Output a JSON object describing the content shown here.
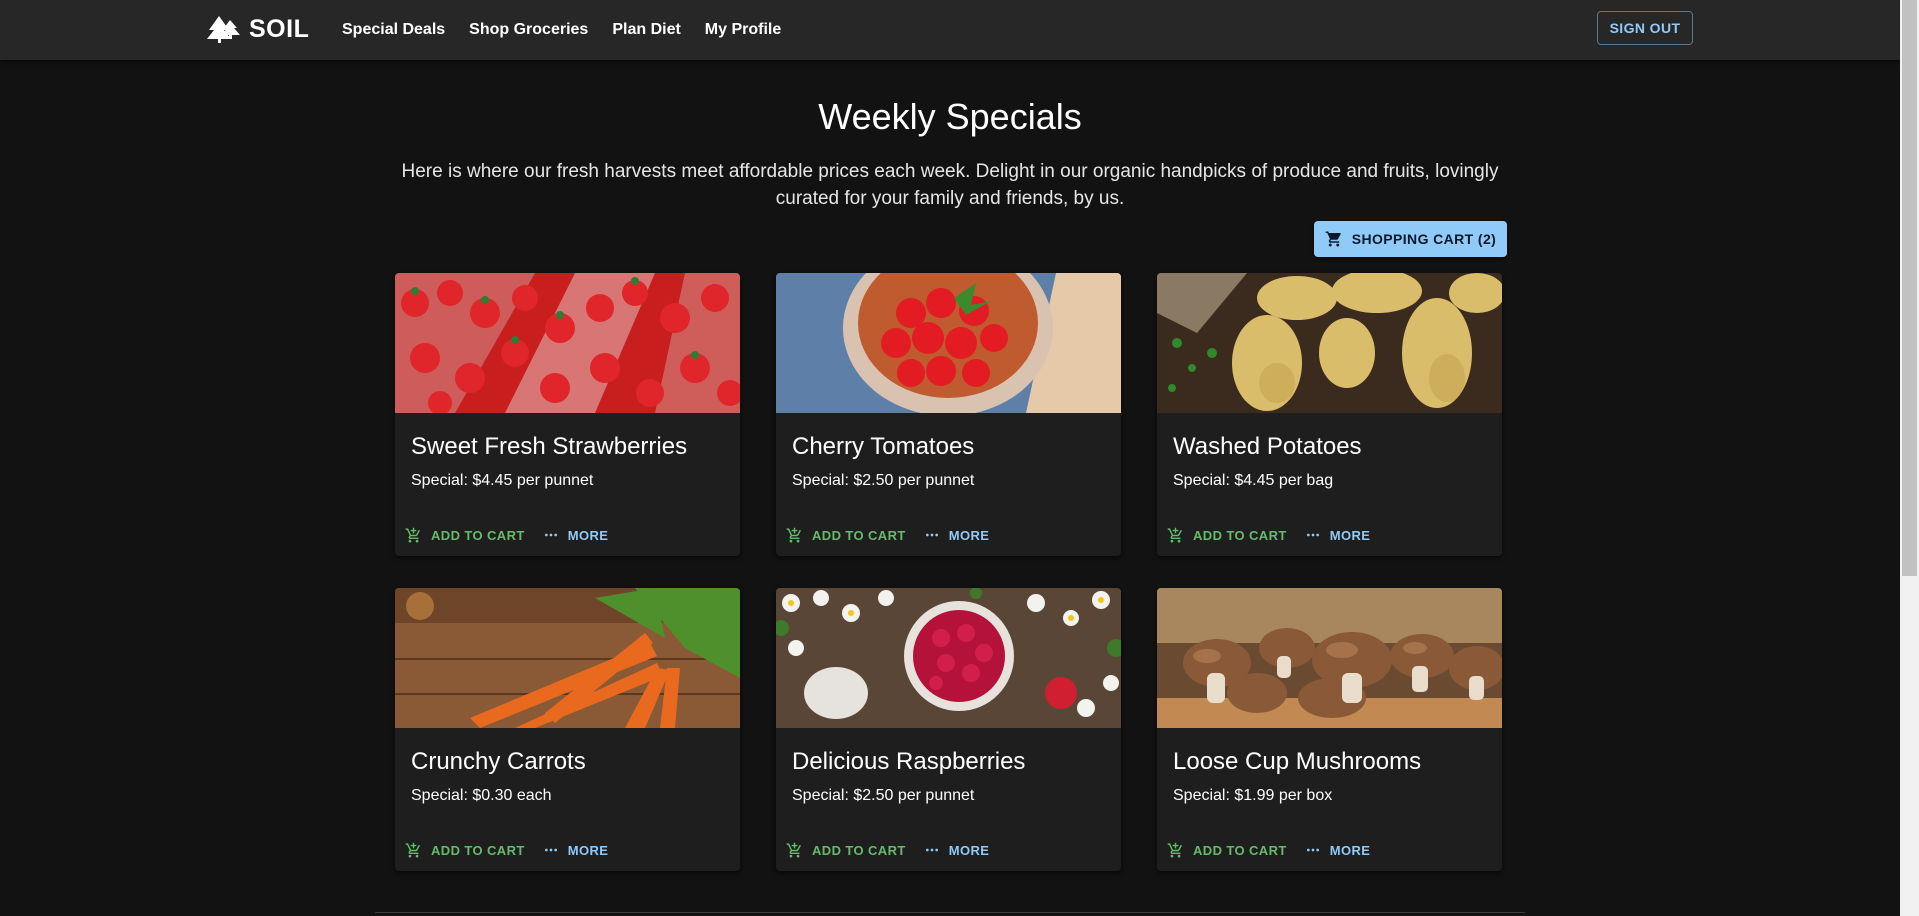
{
  "header": {
    "brand": "SOIL",
    "nav": [
      "Special Deals",
      "Shop Groceries",
      "Plan Diet",
      "My Profile"
    ],
    "sign_out": "SIGN OUT"
  },
  "main": {
    "title": "Weekly Specials",
    "subtitle": "Here is where our fresh harvests meet affordable prices each week. Delight in our organic handpicks of produce and fruits, lovingly curated for your family and friends, by us.",
    "cart_button": "SHOPPING CART (2)"
  },
  "products": [
    {
      "name": "Sweet Fresh Strawberries",
      "price": "Special: $4.45 per punnet",
      "image": "strawberries-photo"
    },
    {
      "name": "Cherry Tomatoes",
      "price": "Special: $2.50 per punnet",
      "image": "cherry-tomatoes-photo"
    },
    {
      "name": "Washed Potatoes",
      "price": "Special: $4.45 per bag",
      "image": "potatoes-photo"
    },
    {
      "name": "Crunchy Carrots",
      "price": "Special: $0.30 each",
      "image": "carrots-photo"
    },
    {
      "name": "Delicious Raspberries",
      "price": "Special: $2.50 per punnet",
      "image": "raspberries-photo"
    },
    {
      "name": "Loose Cup Mushrooms",
      "price": "Special: $1.99 per box",
      "image": "mushrooms-photo"
    }
  ],
  "card_actions": {
    "add_to_cart": "ADD TO CART",
    "more": "MORE"
  },
  "colors": {
    "background": "#121212",
    "appbar": "#272727",
    "card": "#1e1e1e",
    "primary": "#90caf9",
    "success": "#66bb6a"
  },
  "icons": {
    "logo": "trees-icon",
    "cart": "shopping-cart-icon",
    "add": "add-shopping-cart-icon",
    "more": "more-horiz-icon"
  }
}
